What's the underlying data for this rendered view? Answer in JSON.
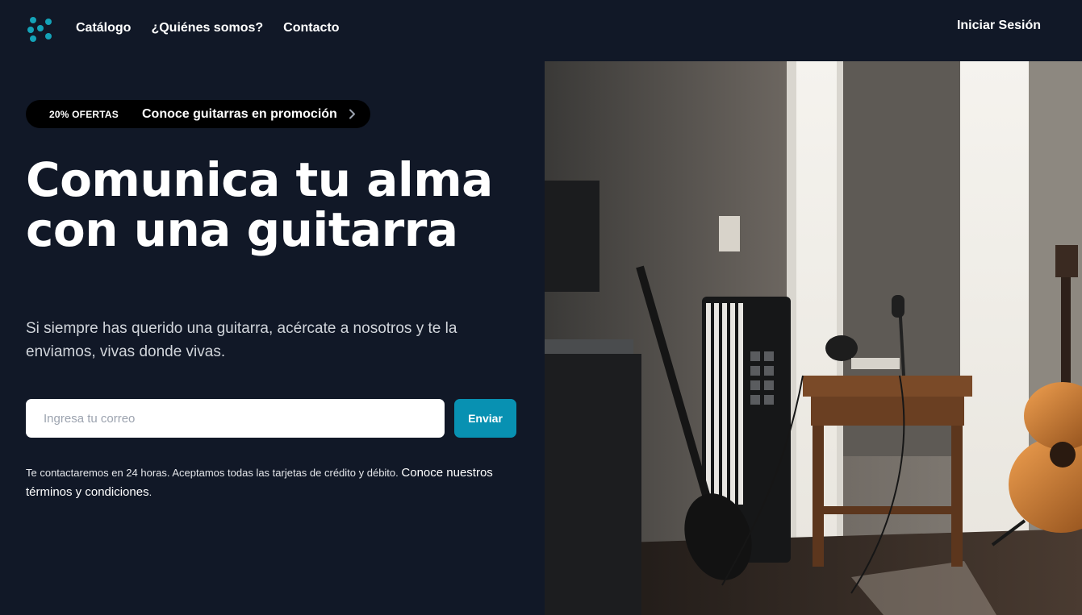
{
  "header": {
    "logo_icon": "dots-logo-icon",
    "nav": [
      {
        "label": "Catálogo"
      },
      {
        "label": "¿Quiénes somos?"
      },
      {
        "label": "Contacto"
      }
    ],
    "login_label": "Iniciar Sesión"
  },
  "promo": {
    "badge": "20% OFERTAS",
    "text": "Conoce guitarras en promoción",
    "icon": "chevron-right-icon"
  },
  "hero": {
    "title_line1": "Comunica tu alma",
    "title_line2": "con una guitarra",
    "subtitle": "Si siempre has querido una guitarra, acércate a nosotros y te la enviamos, vivas donde vivas."
  },
  "form": {
    "email_placeholder": "Ingresa tu correo",
    "email_value": "",
    "send_label": "Enviar"
  },
  "fineprint": {
    "text": "Te contactaremos en 24 horas. Aceptamos todas las tarjetas de crédito y débito.",
    "link": "Conoce nuestros términos y condiciones",
    "suffix": "."
  },
  "colors": {
    "background": "#111827",
    "accent": "#0891b2",
    "logo": "#14a3b8",
    "promo_bg": "#000000"
  }
}
